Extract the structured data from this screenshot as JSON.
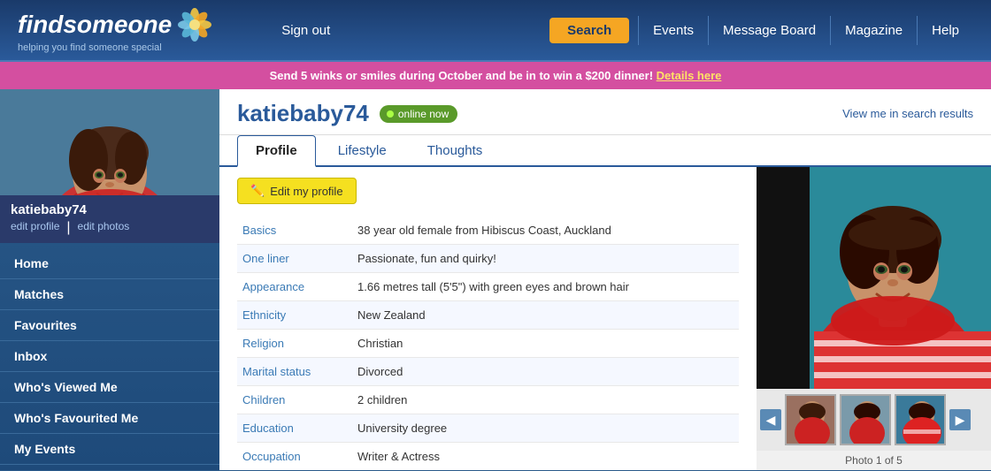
{
  "header": {
    "logo_text": "find",
    "logo_text2": "someone",
    "logo_sub": "helping you find someone special",
    "signout_label": "Sign out",
    "search_label": "Search",
    "events_label": "Events",
    "messageboard_label": "Message Board",
    "magazine_label": "Magazine",
    "help_label": "Help"
  },
  "banner": {
    "text": "Send 5 winks or smiles during October and be in to win a $200 dinner!",
    "link_text": "Details here"
  },
  "sidebar": {
    "username": "katiebaby74",
    "edit_profile_link": "edit profile",
    "edit_photos_link": "edit photos",
    "nav": [
      {
        "label": "Home",
        "id": "home"
      },
      {
        "label": "Matches",
        "id": "matches"
      },
      {
        "label": "Favourites",
        "id": "favourites"
      },
      {
        "label": "Inbox",
        "id": "inbox"
      },
      {
        "label": "Who's Viewed Me",
        "id": "viewed"
      },
      {
        "label": "Who's Favourited Me",
        "id": "favourited"
      },
      {
        "label": "My Events",
        "id": "events"
      }
    ]
  },
  "profile": {
    "username": "katiebaby74",
    "online_label": "online now",
    "view_search_label": "View me in search results",
    "edit_btn_label": "Edit my profile",
    "tabs": [
      {
        "label": "Profile",
        "id": "profile",
        "active": true
      },
      {
        "label": "Lifestyle",
        "id": "lifestyle"
      },
      {
        "label": "Thoughts",
        "id": "thoughts"
      }
    ],
    "fields": [
      {
        "label": "Basics",
        "value": "38 year old female from Hibiscus Coast, Auckland"
      },
      {
        "label": "One liner",
        "value": "Passionate, fun and quirky!"
      },
      {
        "label": "Appearance",
        "value": "1.66 metres tall (5'5\") with green eyes and brown hair"
      },
      {
        "label": "Ethnicity",
        "value": "New Zealand"
      },
      {
        "label": "Religion",
        "value": "Christian"
      },
      {
        "label": "Marital status",
        "value": "Divorced"
      },
      {
        "label": "Children",
        "value": "2 children"
      },
      {
        "label": "Education",
        "value": "University degree"
      },
      {
        "label": "Occupation",
        "value": "Writer & Actress"
      }
    ],
    "photo_label": "Photo 1 of 5"
  }
}
